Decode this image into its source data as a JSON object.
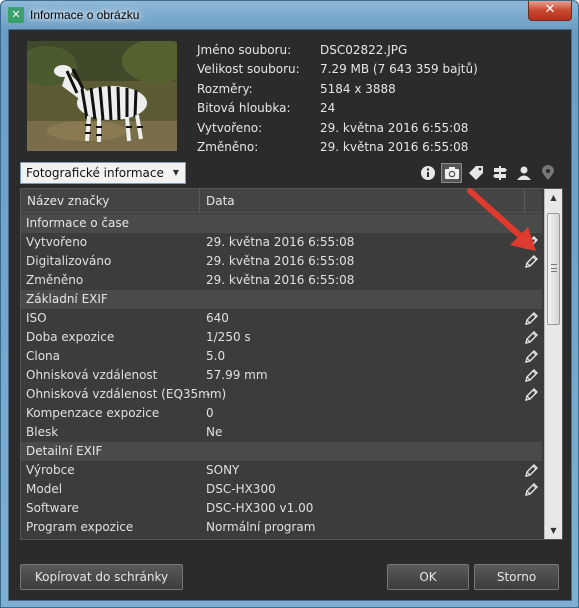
{
  "window": {
    "title": "Informace o obrázku",
    "close_label": "✕"
  },
  "file_info": [
    {
      "label": "Jméno souboru:",
      "value": "DSC02822.JPG"
    },
    {
      "label": "Velikost souboru:",
      "value": "7.29 MB (7 643 359 bajtů)"
    },
    {
      "label": "Rozměry:",
      "value": "5184 x 3888"
    },
    {
      "label": "Bitová hloubka:",
      "value": "24"
    },
    {
      "label": "Vytvořeno:",
      "value": "29. května 2016 6:55:08"
    },
    {
      "label": "Změněno:",
      "value": "29. května 2016 6:55:08"
    }
  ],
  "dropdown": {
    "selected": "Fotografické informace"
  },
  "iconbar": [
    {
      "name": "info-icon"
    },
    {
      "name": "camera-icon",
      "active": true
    },
    {
      "name": "tag-icon"
    },
    {
      "name": "signpost-icon"
    },
    {
      "name": "person-icon"
    },
    {
      "name": "location-pin-icon"
    }
  ],
  "table": {
    "headers": [
      "Název značky",
      "Data"
    ],
    "rows": [
      {
        "type": "group",
        "label": "Informace o čase"
      },
      {
        "type": "item",
        "key": "Vytvořeno",
        "value": "29. května 2016 6:55:08",
        "editable": true
      },
      {
        "type": "item",
        "key": "Digitalizováno",
        "value": "29. května 2016 6:55:08",
        "editable": true
      },
      {
        "type": "item",
        "key": "Změněno",
        "value": "29. května 2016 6:55:08",
        "editable": false
      },
      {
        "type": "group",
        "label": "Základní EXIF"
      },
      {
        "type": "item",
        "key": "ISO",
        "value": "640",
        "editable": true
      },
      {
        "type": "item",
        "key": "Doba expozice",
        "value": "1/250 s",
        "editable": true
      },
      {
        "type": "item",
        "key": "Clona",
        "value": "5.0",
        "editable": true
      },
      {
        "type": "item",
        "key": "Ohnisková vzdálenost",
        "value": "57.99 mm",
        "editable": true
      },
      {
        "type": "item",
        "key": "Ohnisková vzdálenost (EQ35mm)",
        "value": "-",
        "editable": true
      },
      {
        "type": "item",
        "key": "Kompenzace expozice",
        "value": "0",
        "editable": false
      },
      {
        "type": "item",
        "key": "Blesk",
        "value": "Ne",
        "editable": false
      },
      {
        "type": "group",
        "label": "Detailní EXIF"
      },
      {
        "type": "item",
        "key": "Výrobce",
        "value": "SONY",
        "editable": true
      },
      {
        "type": "item",
        "key": "Model",
        "value": "DSC-HX300",
        "editable": true
      },
      {
        "type": "item",
        "key": "Software",
        "value": "DSC-HX300 v1.00",
        "editable": false
      },
      {
        "type": "item",
        "key": "Program expozice",
        "value": "Normální program",
        "editable": false
      }
    ]
  },
  "buttons": {
    "copy": "Kopírovat do schránky",
    "ok": "OK",
    "cancel": "Storno"
  }
}
